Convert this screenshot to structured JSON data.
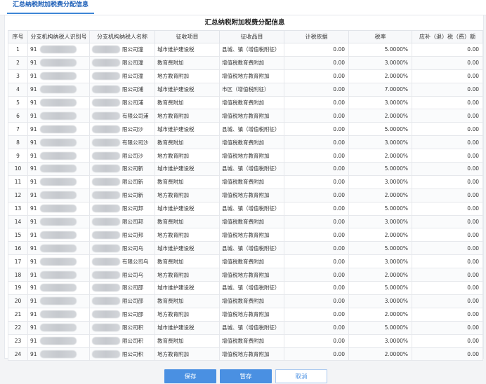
{
  "tab": {
    "label": "汇总纳税附加税费分配信息"
  },
  "table_title": "汇总纳税附加税费分配信息",
  "columns": [
    "序号",
    "分支机构纳税人识别号",
    "分支机构纳税人名称",
    "征收项目",
    "征收品目",
    "计税依据",
    "税率",
    "应补（退）税（费）额"
  ],
  "rows": [
    {
      "idx": "1",
      "tax_id": "91",
      "name": "限公司潼",
      "item": "城市维护建设税",
      "category": "县城、镇（增值税附征）",
      "base": "0.00",
      "rate": "5.0000%",
      "amount": "0.00"
    },
    {
      "idx": "2",
      "tax_id": "91",
      "name": "限公司潼",
      "item": "教育费附加",
      "category": "增值税教育费附加",
      "base": "0.00",
      "rate": "3.0000%",
      "amount": "0.00"
    },
    {
      "idx": "3",
      "tax_id": "91",
      "name": "限公司潼",
      "item": "地方教育附加",
      "category": "增值税地方教育附加",
      "base": "0.00",
      "rate": "2.0000%",
      "amount": "0.00"
    },
    {
      "idx": "4",
      "tax_id": "91",
      "name": "限公司浦",
      "item": "城市维护建设税",
      "category": "市区（增值税附征）",
      "base": "0.00",
      "rate": "7.0000%",
      "amount": "0.00"
    },
    {
      "idx": "5",
      "tax_id": "91",
      "name": "限公司浦",
      "item": "教育费附加",
      "category": "增值税教育费附加",
      "base": "0.00",
      "rate": "3.0000%",
      "amount": "0.00"
    },
    {
      "idx": "6",
      "tax_id": "91",
      "name": "有限公司浦",
      "item": "地方教育附加",
      "category": "增值税地方教育附加",
      "base": "0.00",
      "rate": "2.0000%",
      "amount": "0.00"
    },
    {
      "idx": "7",
      "tax_id": "91",
      "name": "限公司沙",
      "item": "城市维护建设税",
      "category": "县城、镇（增值税附征）",
      "base": "0.00",
      "rate": "5.0000%",
      "amount": "0.00"
    },
    {
      "idx": "8",
      "tax_id": "91",
      "name": "有限公司沙",
      "item": "教育费附加",
      "category": "增值税教育费附加",
      "base": "0.00",
      "rate": "3.0000%",
      "amount": "0.00"
    },
    {
      "idx": "9",
      "tax_id": "91",
      "name": "限公司沙",
      "item": "地方教育附加",
      "category": "增值税地方教育附加",
      "base": "0.00",
      "rate": "2.0000%",
      "amount": "0.00"
    },
    {
      "idx": "10",
      "tax_id": "91",
      "name": "限公司新",
      "item": "城市维护建设税",
      "category": "县城、镇（增值税附征）",
      "base": "0.00",
      "rate": "5.0000%",
      "amount": "0.00"
    },
    {
      "idx": "11",
      "tax_id": "91",
      "name": "限公司新",
      "item": "教育费附加",
      "category": "增值税教育费附加",
      "base": "0.00",
      "rate": "3.0000%",
      "amount": "0.00"
    },
    {
      "idx": "12",
      "tax_id": "91",
      "name": "限公司新",
      "item": "地方教育附加",
      "category": "增值税地方教育附加",
      "base": "0.00",
      "rate": "2.0000%",
      "amount": "0.00"
    },
    {
      "idx": "13",
      "tax_id": "91",
      "name": "限公司邦",
      "item": "城市维护建设税",
      "category": "县城、镇（增值税附征）",
      "base": "0.00",
      "rate": "5.0000%",
      "amount": "0.00"
    },
    {
      "idx": "14",
      "tax_id": "91",
      "name": "限公司邦",
      "item": "教育费附加",
      "category": "增值税教育费附加",
      "base": "0.00",
      "rate": "3.0000%",
      "amount": "0.00"
    },
    {
      "idx": "15",
      "tax_id": "91",
      "name": "限公司邦",
      "item": "地方教育附加",
      "category": "增值税地方教育附加",
      "base": "0.00",
      "rate": "2.0000%",
      "amount": "0.00"
    },
    {
      "idx": "16",
      "tax_id": "91",
      "name": "限公司乌",
      "item": "城市维护建设税",
      "category": "县城、镇（增值税附征）",
      "base": "0.00",
      "rate": "5.0000%",
      "amount": "0.00"
    },
    {
      "idx": "17",
      "tax_id": "91",
      "name": "有限公司乌",
      "item": "教育费附加",
      "category": "增值税教育费附加",
      "base": "0.00",
      "rate": "3.0000%",
      "amount": "0.00"
    },
    {
      "idx": "18",
      "tax_id": "91",
      "name": "限公司乌",
      "item": "地方教育附加",
      "category": "增值税地方教育附加",
      "base": "0.00",
      "rate": "2.0000%",
      "amount": "0.00"
    },
    {
      "idx": "19",
      "tax_id": "91",
      "name": "限公司邵",
      "item": "城市维护建设税",
      "category": "县城、镇（增值税附征）",
      "base": "0.00",
      "rate": "5.0000%",
      "amount": "0.00"
    },
    {
      "idx": "20",
      "tax_id": "91",
      "name": "限公司邵",
      "item": "教育费附加",
      "category": "增值税教育费附加",
      "base": "0.00",
      "rate": "3.0000%",
      "amount": "0.00"
    },
    {
      "idx": "21",
      "tax_id": "91",
      "name": "限公司邵",
      "item": "地方教育附加",
      "category": "增值税地方教育附加",
      "base": "0.00",
      "rate": "2.0000%",
      "amount": "0.00"
    },
    {
      "idx": "22",
      "tax_id": "91",
      "name": "限公司积",
      "item": "城市维护建设税",
      "category": "县城、镇（增值税附征）",
      "base": "0.00",
      "rate": "5.0000%",
      "amount": "0.00"
    },
    {
      "idx": "23",
      "tax_id": "91",
      "name": "限公司积",
      "item": "教育费附加",
      "category": "增值税教育费附加",
      "base": "0.00",
      "rate": "3.0000%",
      "amount": "0.00"
    },
    {
      "idx": "24",
      "tax_id": "91",
      "name": "限公司积",
      "item": "地方教育附加",
      "category": "增值税地方教育附加",
      "base": "0.00",
      "rate": "2.0000%",
      "amount": "0.00"
    }
  ],
  "buttons": {
    "save": "保存",
    "draft": "暂存",
    "cancel": "取消"
  },
  "colors": {
    "accent": "#4a90e2",
    "tab_text": "#1d5fb8"
  }
}
